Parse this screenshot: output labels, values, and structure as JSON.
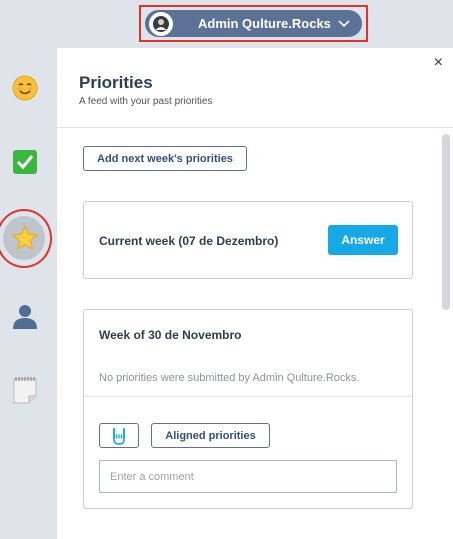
{
  "user": {
    "name": "Admin Qulture.Rocks"
  },
  "sidebar": {
    "items": [
      {
        "icon": "smiling-face-icon",
        "glyph": "☺️"
      },
      {
        "icon": "check-mark-icon",
        "glyph": "✅"
      },
      {
        "icon": "star-icon",
        "glyph": "⭐"
      },
      {
        "icon": "person-silhouette-icon",
        "glyph": "👤"
      },
      {
        "icon": "notepad-icon",
        "glyph": "🗒️"
      }
    ]
  },
  "panel": {
    "title": "Priorities",
    "subtitle": "A feed with your past priorities",
    "close": "×",
    "add_button": "Add next week's priorities",
    "current_week": {
      "label": "Current week (07 de Dezembro)",
      "answer_button": "Answer"
    },
    "past_week": {
      "title": "Week of 30 de Novembro",
      "empty_message": "No priorities were submitted by Admin Qulture.Rocks.",
      "aligned_button": "Aligned priorities",
      "comment_placeholder": "Enter a comment"
    }
  },
  "colors": {
    "accent": "#17a8e6",
    "pill": "#5b7296",
    "highlight": "#e0332a",
    "background": "#dfe3ea"
  }
}
